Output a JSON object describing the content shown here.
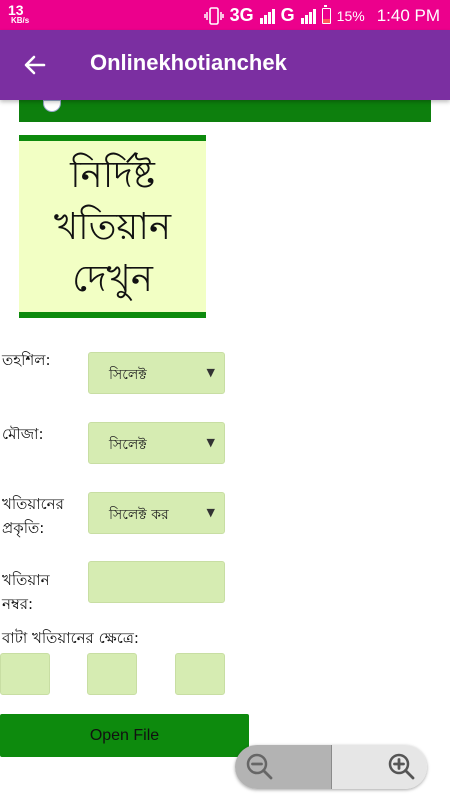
{
  "status_bar": {
    "speed_value": "13",
    "speed_unit": "KB/s",
    "network_3g": "3G",
    "network_g": "G",
    "battery_percent": "15%",
    "time": "1:40 PM"
  },
  "app_bar": {
    "title": "Onlinekhotianchek",
    "back_icon": "arrow-left-icon",
    "color": "#7b2fa1"
  },
  "title_box": {
    "lines": [
      "নির্দিষ্ট",
      "খতিয়ান",
      "দেখুন"
    ]
  },
  "form": {
    "tehsil": {
      "label": "তহশিল:",
      "value": "সিলেক্ট"
    },
    "mouza": {
      "label": "মৌজা:",
      "value": "সিলেক্ট"
    },
    "khatian_type": {
      "label_line1": "খতিয়ানের",
      "label_line2": "প্রকৃতি:",
      "value": "সিলেক্ট কর"
    },
    "khatian_number": {
      "label_line1": "খতিয়ান",
      "label_line2": "নম্বর:",
      "value": ""
    },
    "bata_khatian": {
      "label": "বাটা খতিয়ানের ক্ষেত্রে:",
      "values": [
        "",
        "",
        ""
      ]
    },
    "open_button": "Open File"
  },
  "zoom": {
    "out_icon": "zoom-out-icon",
    "in_icon": "zoom-in-icon"
  },
  "colors": {
    "status_bar": "#ec008c",
    "accent_green": "#0d8a0d",
    "field_bg": "#d6ecb2",
    "title_bg": "#f2ffc4"
  }
}
